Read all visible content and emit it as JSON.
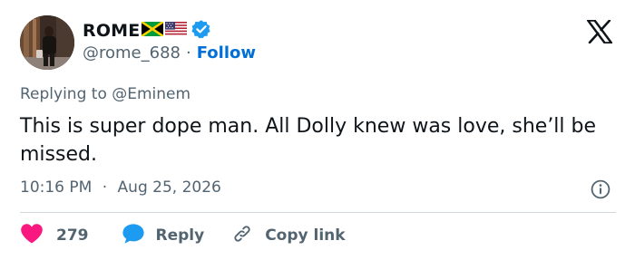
{
  "user": {
    "display_name": "ROME",
    "handle": "@rome_688",
    "follow_label": "Follow",
    "separator": "·",
    "flags": [
      "jamaica-flag",
      "usa-flag"
    ],
    "verified_icon": "verified-badge-icon"
  },
  "platform_logo": "x-logo-icon",
  "tweet": {
    "reply_prefix": "Replying to",
    "reply_to": "@Eminem",
    "text": "This is super dope man. All Dolly knew was love, she’ll be missed.",
    "time": "10:16 PM",
    "separator": "·",
    "date": "Aug 25, 2026"
  },
  "actions": {
    "likes_count": "279",
    "reply_label": "Reply",
    "copy_link_label": "Copy link"
  },
  "colors": {
    "text": "#0f1419",
    "muted": "#536471",
    "link": "#006fd6",
    "like": "#f91880",
    "reply": "#1d9bf0",
    "verified": "#1d9bf0",
    "divider": "#cfd9de"
  },
  "icons": {
    "like": "heart-icon",
    "reply": "speech-bubble-icon",
    "copy_link": "link-icon",
    "info": "info-icon"
  }
}
